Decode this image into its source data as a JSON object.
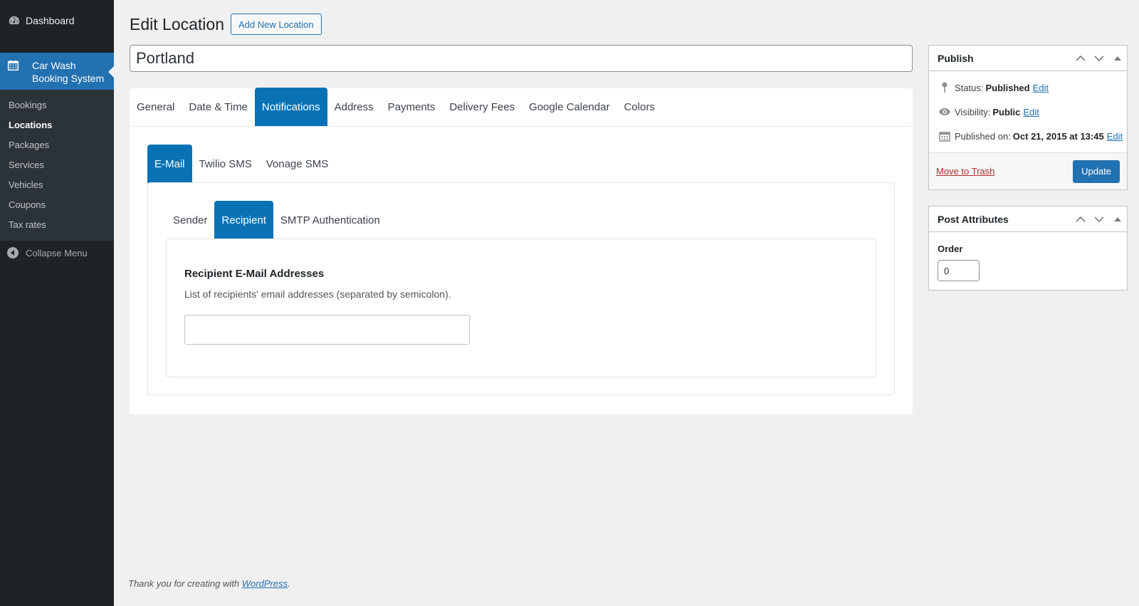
{
  "sidebar": {
    "dashboard_label": "Dashboard",
    "current_label_line1": "Car Wash",
    "current_label_line2": "Booking System",
    "submenu": [
      "Bookings",
      "Locations",
      "Packages",
      "Services",
      "Vehicles",
      "Coupons",
      "Tax rates"
    ],
    "current_submenu": "Locations",
    "collapse_label": "Collapse Menu"
  },
  "header": {
    "title": "Edit Location",
    "add_new_label": "Add New Location"
  },
  "post_title": "Portland",
  "tabs": [
    "General",
    "Date & Time",
    "Notifications",
    "Address",
    "Payments",
    "Delivery Fees",
    "Google Calendar",
    "Colors"
  ],
  "active_tab": "Notifications",
  "subtabs": [
    "E-Mail",
    "Twilio SMS",
    "Vonage SMS"
  ],
  "active_subtab": "E-Mail",
  "innertabs": [
    "Sender",
    "Recipient",
    "SMTP Authentication"
  ],
  "active_innertab": "Recipient",
  "recipient": {
    "title": "Recipient E-Mail Addresses",
    "description": "List of recipients' email addresses (separated by semicolon).",
    "value": ""
  },
  "publish": {
    "title": "Publish",
    "status_label": "Status:",
    "status_value": "Published",
    "visibility_label": "Visibility:",
    "visibility_value": "Public",
    "published_label": "Published on:",
    "published_value": "Oct 21, 2015 at 13:45",
    "edit_label": "Edit",
    "trash_label": "Move to Trash",
    "update_label": "Update"
  },
  "attributes": {
    "title": "Post Attributes",
    "order_label": "Order",
    "order_value": "0"
  },
  "footer": {
    "text": "Thank you for creating with",
    "link": "WordPress",
    "suffix": "."
  },
  "colors": {
    "accent": "#2271b1",
    "tab_active": "#0872b5",
    "sidebar_bg": "#1d2327"
  }
}
